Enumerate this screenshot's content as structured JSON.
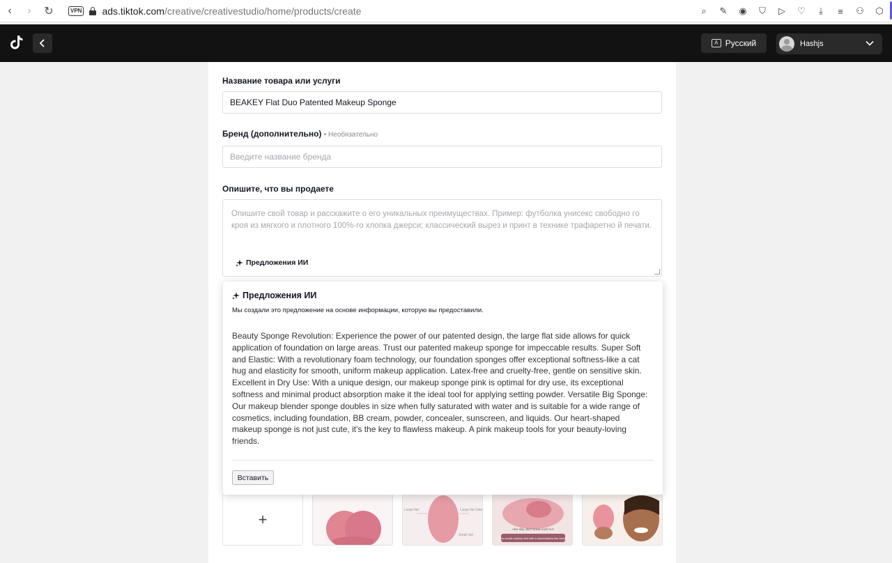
{
  "browser": {
    "vpn_label": "VPN",
    "url_host": "ads.tiktok.com",
    "url_path": "/creative/creativestudio/home/products/create"
  },
  "header": {
    "language_label": "Русский",
    "user_name": "Hashjs"
  },
  "form": {
    "product_name_label": "Название товара или услуги",
    "product_name_value": "BEAKEY Flat Duo Patented Makeup Sponge",
    "brand_label": "Бренд (дополнительно)",
    "brand_optional": "• Необязательно",
    "brand_placeholder": "Введите название бренда",
    "description_label": "Опишите, что вы продаете",
    "description_placeholder": "Опишите свой товар и расскажите о его уникальных преимуществах. Пример: футболка унисекс свободно го кроя из мягкого и плотного 100%-го хлопка джерси; классический вырез и принт в технике трафаретно й печати.",
    "ai_suggestions_chip": "Предложения ИИ"
  },
  "ai_popover": {
    "title": "Предложения ИИ",
    "subtitle": "Мы создали это предложение на основе информации, которую вы предоставили.",
    "text": "Beauty Sponge Revolution: Experience the power of our patented design, the large flat side allows for quick application of foundation on large areas. Trust our patented makeup sponge for impeccable results. Super Soft and Elastic: With a revolutionary foam technology, our foundation sponges offer exceptional softness-like a cat hug and elasticity for smooth, uniform makeup application. Latex-free and cruelty-free, gentle on sensitive skin. Excellent in Dry Use: With a unique design, our makeup sponge pink is optimal for dry use, its exceptional softness and minimal product absorption make it the ideal tool for applying setting powder. Versatile Big Sponge: Our makeup blender sponge doubles in size when fully saturated with water and is suitable for a wide range of cosmetics, including foundation, BB cream, powder, concealer, sunscreen, and liquids. Our heart-shaped makeup sponge is not just cute, it's the key to flawless makeup. A pink makeup tools for your beauty-loving friends.",
    "insert_button": "Вставить"
  },
  "images": {
    "add_symbol": "+",
    "tile3_left_label": "Large flat",
    "tile3_right_label": "Large flat Side",
    "tile3_bottom_label": "Small dot",
    "tile4_caption": "nice day, don't know each it is",
    "tile4_banner": "How would makeup feel with a marshmallow like touch?"
  },
  "colors": {
    "accent_pink": "#e38a96",
    "header_bg": "#121212"
  }
}
